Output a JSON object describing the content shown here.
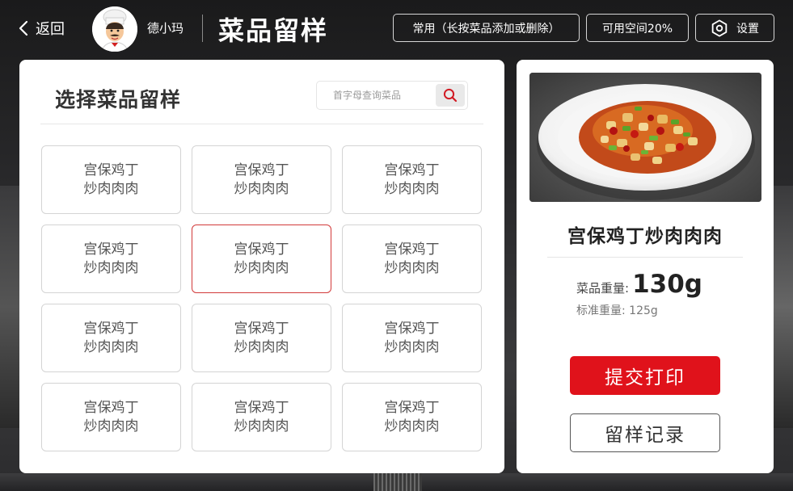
{
  "header": {
    "back_label": "返回",
    "back_icon": "chevron-left-icon",
    "user_name": "德小玛",
    "page_title": "菜品留样",
    "common_label": "常用（长按菜品添加或删除）",
    "space_label": "可用空间20%",
    "settings_label": "设置",
    "settings_icon": "gear-icon"
  },
  "left_panel": {
    "title": "选择菜品留样",
    "search_placeholder": "首字母查询菜品",
    "search_icon": "search-icon",
    "dishes": [
      {
        "line1": "宫保鸡丁",
        "line2": "炒肉肉肉",
        "selected": false
      },
      {
        "line1": "宫保鸡丁",
        "line2": "炒肉肉肉",
        "selected": false
      },
      {
        "line1": "宫保鸡丁",
        "line2": "炒肉肉肉",
        "selected": false
      },
      {
        "line1": "宫保鸡丁",
        "line2": "炒肉肉肉",
        "selected": false
      },
      {
        "line1": "宫保鸡丁",
        "line2": "炒肉肉肉",
        "selected": true
      },
      {
        "line1": "宫保鸡丁",
        "line2": "炒肉肉肉",
        "selected": false
      },
      {
        "line1": "宫保鸡丁",
        "line2": "炒肉肉肉",
        "selected": false
      },
      {
        "line1": "宫保鸡丁",
        "line2": "炒肉肉肉",
        "selected": false
      },
      {
        "line1": "宫保鸡丁",
        "line2": "炒肉肉肉",
        "selected": false
      },
      {
        "line1": "宫保鸡丁",
        "line2": "炒肉肉肉",
        "selected": false
      },
      {
        "line1": "宫保鸡丁",
        "line2": "炒肉肉肉",
        "selected": false
      },
      {
        "line1": "宫保鸡丁",
        "line2": "炒肉肉肉",
        "selected": false
      }
    ]
  },
  "right_panel": {
    "dish_name": "宫保鸡丁炒肉肉肉",
    "weight_label": "菜品重量:",
    "weight_value": "130g",
    "standard_label": "标准重量:",
    "standard_value": "125g",
    "submit_label": "提交打印",
    "records_label": "留样记录"
  },
  "colors": {
    "accent_red": "#e0121b",
    "selected_border": "#d23a3a",
    "background_dark": "#1e1e20"
  }
}
